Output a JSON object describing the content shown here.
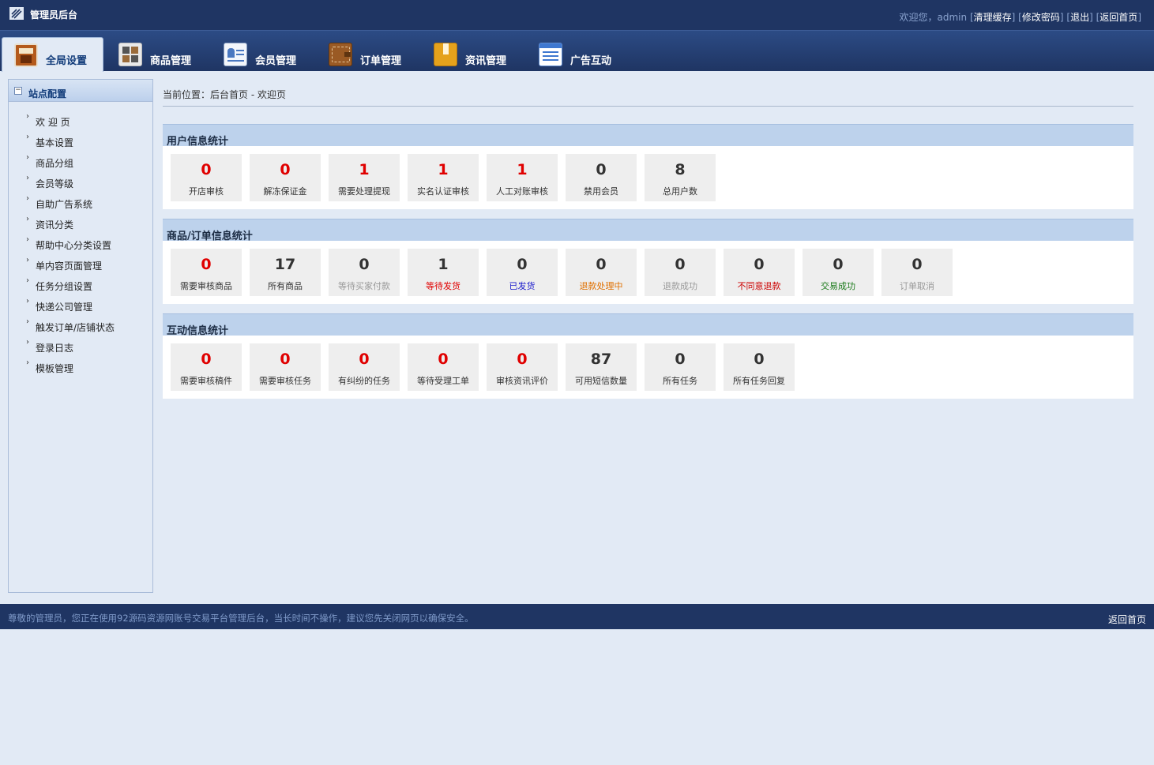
{
  "topbar": {
    "title": "管理员后台",
    "welcome": "欢迎您，admin",
    "links": [
      "清理缓存",
      "修改密码",
      "退出",
      "返回首页"
    ]
  },
  "nav": {
    "items": [
      {
        "label": "全局设置",
        "icon": "global-settings-icon",
        "active": true
      },
      {
        "label": "商品管理",
        "icon": "goods-icon"
      },
      {
        "label": "会员管理",
        "icon": "member-card-icon"
      },
      {
        "label": "订单管理",
        "icon": "wallet-icon"
      },
      {
        "label": "资讯管理",
        "icon": "bookmark-folder-icon"
      },
      {
        "label": "广告互动",
        "icon": "list-window-icon"
      }
    ]
  },
  "sidebar": {
    "title": "站点配置",
    "items": [
      "欢 迎 页",
      "基本设置",
      "商品分组",
      "会员等级",
      "自助广告系统",
      "资讯分类",
      "帮助中心分类设置",
      "单内容页面管理",
      "任务分组设置",
      "快递公司管理",
      "触发订单/店铺状态",
      "登录日志",
      "模板管理"
    ]
  },
  "breadcrumb": "当前位置：后台首页 - 欢迎页",
  "sections": [
    {
      "title": "用户信息统计",
      "cards": [
        {
          "value": "0",
          "label": "开店审核",
          "value_color": "#e00000",
          "label_color": "#333333"
        },
        {
          "value": "0",
          "label": "解冻保证金",
          "value_color": "#e00000",
          "label_color": "#333333"
        },
        {
          "value": "1",
          "label": "需要处理提现",
          "value_color": "#e00000",
          "label_color": "#333333"
        },
        {
          "value": "1",
          "label": "实名认证审核",
          "value_color": "#e00000",
          "label_color": "#333333"
        },
        {
          "value": "1",
          "label": "人工对账审核",
          "value_color": "#e00000",
          "label_color": "#333333"
        },
        {
          "value": "0",
          "label": "禁用会员",
          "value_color": "#333333",
          "label_color": "#333333"
        },
        {
          "value": "8",
          "label": "总用户数",
          "value_color": "#333333",
          "label_color": "#333333"
        }
      ]
    },
    {
      "title": "商品/订单信息统计",
      "cards": [
        {
          "value": "0",
          "label": "需要审核商品",
          "value_color": "#e00000",
          "label_color": "#333333"
        },
        {
          "value": "17",
          "label": "所有商品",
          "value_color": "#333333",
          "label_color": "#333333"
        },
        {
          "value": "0",
          "label": "等待买家付款",
          "value_color": "#333333",
          "label_color": "#999999"
        },
        {
          "value": "1",
          "label": "等待发货",
          "value_color": "#333333",
          "label_color": "#e00000"
        },
        {
          "value": "0",
          "label": "已发货",
          "value_color": "#333333",
          "label_color": "#1a1acc"
        },
        {
          "value": "0",
          "label": "退款处理中",
          "value_color": "#333333",
          "label_color": "#e07000"
        },
        {
          "value": "0",
          "label": "退款成功",
          "value_color": "#333333",
          "label_color": "#999999"
        },
        {
          "value": "0",
          "label": "不同意退款",
          "value_color": "#333333",
          "label_color": "#cc0000"
        },
        {
          "value": "0",
          "label": "交易成功",
          "value_color": "#333333",
          "label_color": "#1a7a1a"
        },
        {
          "value": "0",
          "label": "订单取消",
          "value_color": "#333333",
          "label_color": "#999999"
        }
      ]
    },
    {
      "title": "互动信息统计",
      "cards": [
        {
          "value": "0",
          "label": "需要审核稿件",
          "value_color": "#e00000",
          "label_color": "#333333"
        },
        {
          "value": "0",
          "label": "需要审核任务",
          "value_color": "#e00000",
          "label_color": "#333333"
        },
        {
          "value": "0",
          "label": "有纠纷的任务",
          "value_color": "#e00000",
          "label_color": "#333333"
        },
        {
          "value": "0",
          "label": "等待受理工单",
          "value_color": "#e00000",
          "label_color": "#333333"
        },
        {
          "value": "0",
          "label": "审核资讯评价",
          "value_color": "#e00000",
          "label_color": "#333333"
        },
        {
          "value": "87",
          "label": "可用短信数量",
          "value_color": "#333333",
          "label_color": "#333333"
        },
        {
          "value": "0",
          "label": "所有任务",
          "value_color": "#333333",
          "label_color": "#333333"
        },
        {
          "value": "0",
          "label": "所有任务回复",
          "value_color": "#333333",
          "label_color": "#333333"
        }
      ]
    }
  ],
  "footer": {
    "notice": "尊敬的管理员，您正在使用92源码资源网账号交易平台管理后台，当长时间不操作，建议您先关闭网页以确保安全。",
    "back": "返回首页"
  }
}
